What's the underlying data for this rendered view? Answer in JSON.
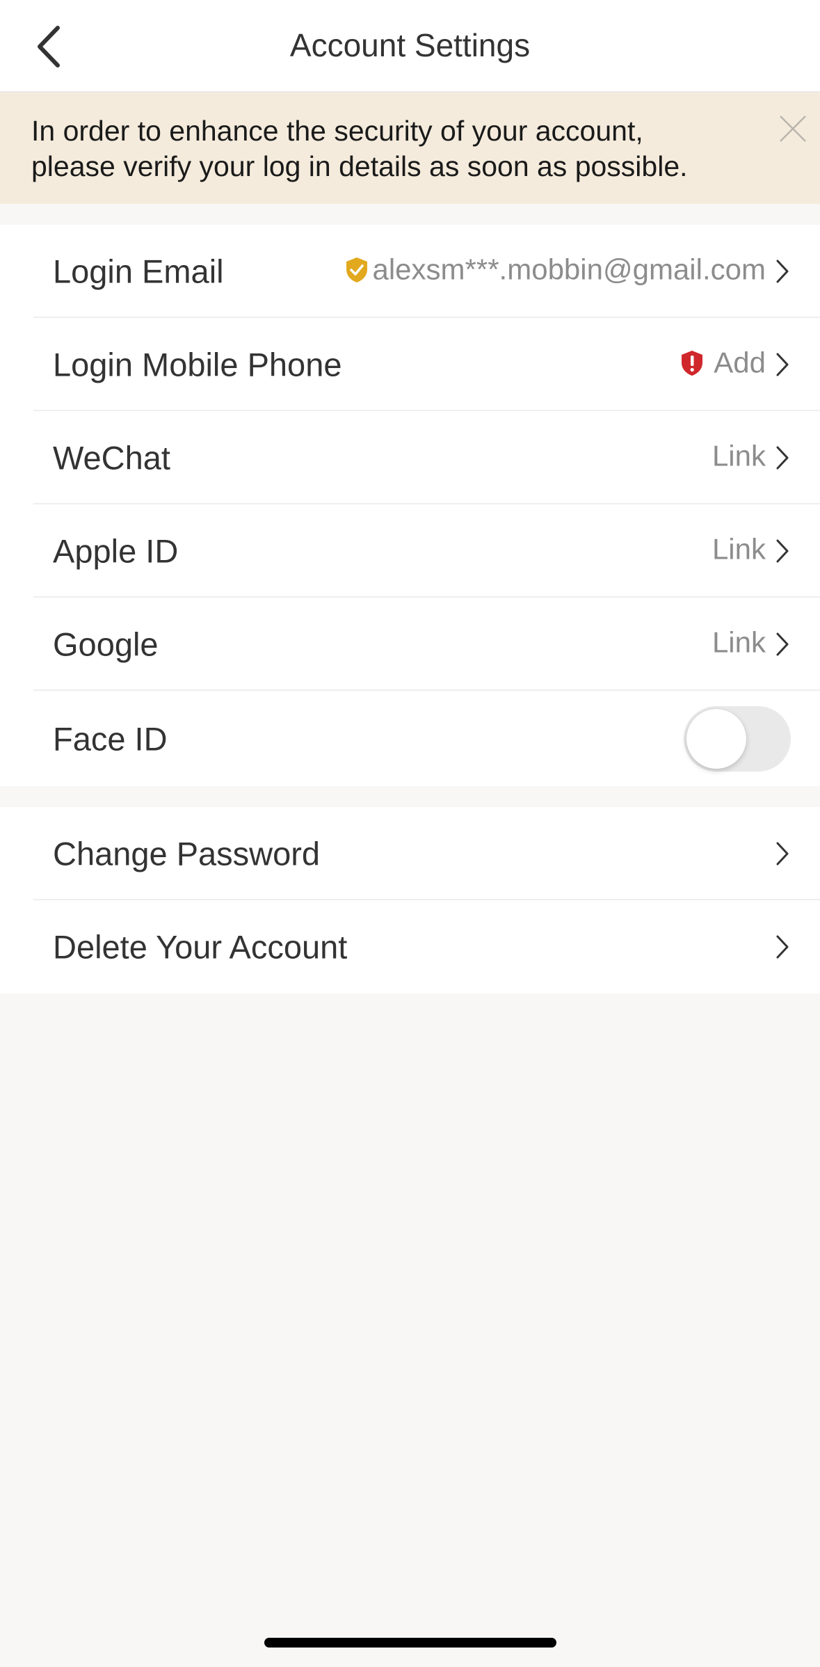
{
  "header": {
    "title": "Account Settings",
    "back_icon": "chevron-left-icon"
  },
  "banner": {
    "line1": "In order to enhance the security of your account,",
    "line2": "please verify your log in details as soon as possible.",
    "close_icon": "close-icon",
    "background": "#f4ebdc"
  },
  "account_links": [
    {
      "label": "Login Email",
      "value": "alexsm***.mobbin@gmail.com",
      "badge": "shield-check-icon",
      "badge_color": "#e2a91f"
    },
    {
      "label": "Login Mobile Phone",
      "value": "Add",
      "badge": "shield-alert-icon",
      "badge_color": "#d0272c"
    },
    {
      "label": "WeChat",
      "value": "Link"
    },
    {
      "label": "Apple ID",
      "value": "Link"
    },
    {
      "label": "Google",
      "value": "Link"
    },
    {
      "label": "Face ID",
      "toggle_on": false
    }
  ],
  "account_actions": [
    {
      "label": "Change Password"
    },
    {
      "label": "Delete Your Account"
    }
  ]
}
